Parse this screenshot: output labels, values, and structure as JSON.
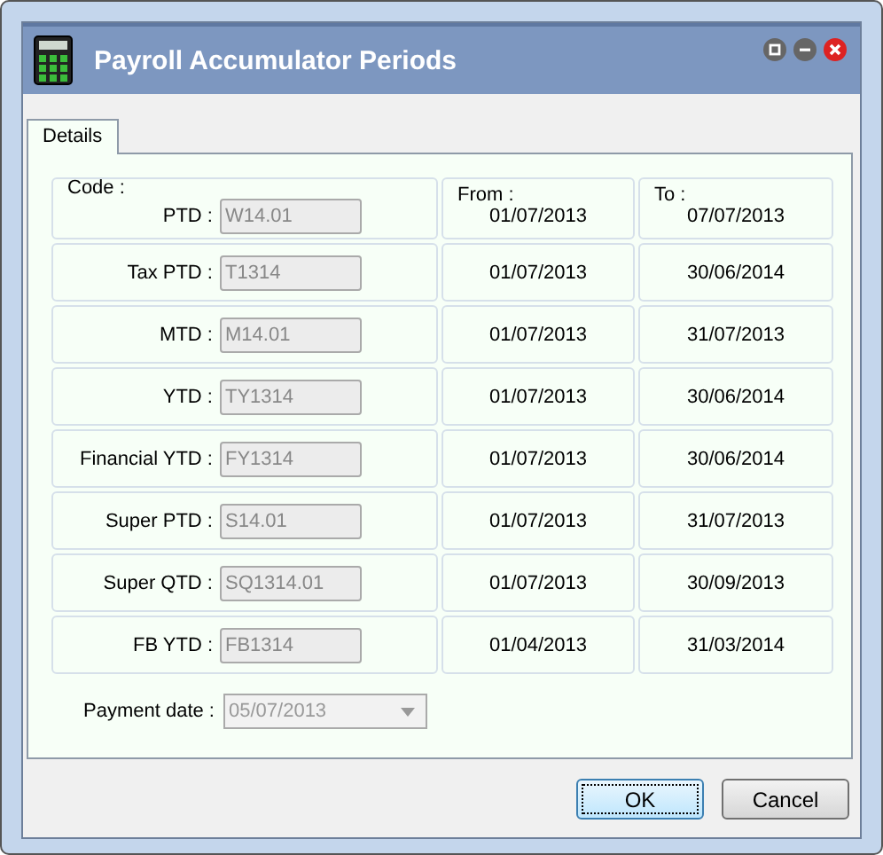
{
  "window": {
    "title": "Payroll Accumulator Periods"
  },
  "tabs": [
    {
      "label": "Details",
      "selected": true
    }
  ],
  "headers": {
    "code": "Code :",
    "from": "From :",
    "to": "To :"
  },
  "periods": [
    {
      "label": "PTD :",
      "code": "W14.01",
      "disabled": true,
      "from": "01/07/2013",
      "to": "07/07/2013"
    },
    {
      "label": "Tax PTD :",
      "code": "T1314",
      "disabled": true,
      "from": "01/07/2013",
      "to": "30/06/2014"
    },
    {
      "label": "MTD :",
      "code": "M14.01",
      "disabled": true,
      "from": "01/07/2013",
      "to": "31/07/2013"
    },
    {
      "label": "YTD :",
      "code": "TY1314",
      "disabled": true,
      "from": "01/07/2013",
      "to": "30/06/2014"
    },
    {
      "label": "Financial YTD :",
      "code": "FY1314",
      "disabled": true,
      "from": "01/07/2013",
      "to": "30/06/2014"
    },
    {
      "label": "Super PTD :",
      "code": "S14.01",
      "disabled": true,
      "from": "01/07/2013",
      "to": "31/07/2013"
    },
    {
      "label": "Super QTD :",
      "code": "SQ1314.01",
      "disabled": true,
      "from": "01/07/2013",
      "to": "30/09/2013"
    },
    {
      "label": "FB YTD :",
      "code": "FB1314",
      "disabled": true,
      "from": "01/04/2013",
      "to": "31/03/2014"
    }
  ],
  "payment_date": {
    "label": "Payment date :",
    "value": "05/07/2013",
    "disabled": true
  },
  "buttons": [
    {
      "label": "OK",
      "default": true
    },
    {
      "label": "Cancel",
      "default": false
    }
  ]
}
